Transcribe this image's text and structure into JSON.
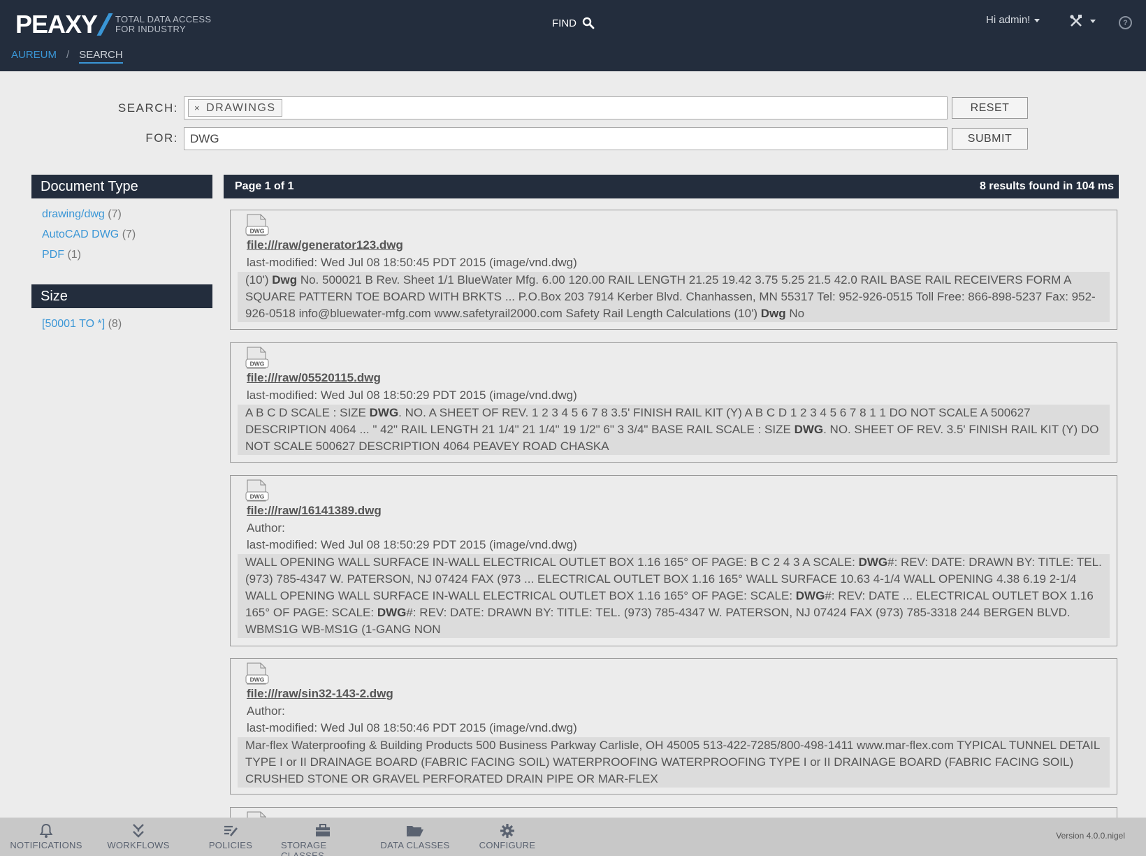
{
  "header": {
    "logo": "PEAXY",
    "tagline_line1": "TOTAL DATA ACCESS",
    "tagline_line2": "FOR INDUSTRY",
    "find_label": "FIND",
    "user_greeting": "Hi admin!",
    "help_label": "?",
    "breadcrumb": {
      "root": "AUREUM",
      "separator": "/",
      "current": "SEARCH"
    }
  },
  "search_form": {
    "search_label": "SEARCH:",
    "chip_remove": "×",
    "chip_label": "DRAWINGS",
    "for_label": "FOR:",
    "for_value": "DWG",
    "reset_label": "RESET",
    "submit_label": "SUBMIT"
  },
  "facets": {
    "doc_type_title": "Document Type",
    "doc_type_items": [
      {
        "label": "drawing/dwg",
        "count": "(7)"
      },
      {
        "label": "AutoCAD DWG",
        "count": "(7)"
      },
      {
        "label": "PDF",
        "count": "(1)"
      }
    ],
    "size_title": "Size",
    "size_items": [
      {
        "label": "[50001 TO *]",
        "count": "(8)"
      }
    ]
  },
  "results": {
    "page_label": "Page 1 of 1",
    "summary": "8 results found in 104 ms",
    "icon_label": "DWG",
    "items": [
      {
        "path": "file:///raw/generator123.dwg",
        "meta": "last-modified: Wed Jul 08 18:50:45 PDT 2015 (image/vnd.dwg)",
        "snippet_html": "(10') <b>Dwg</b> No. 500021 B Rev. Sheet 1/1 BlueWater Mfg. 6.00 120.00 RAIL LENGTH 21.25 19.42 3.75 5.25 21.5 42.0 RAIL BASE RAIL RECEIVERS FORM A SQUARE PATTERN TOE BOARD WITH BRKTS ... P.O.Box 203 7914 Kerber Blvd. Chanhassen, MN 55317 Tel: 952-926-0515 Toll Free: 866-898-5237 Fax: 952-926-0518 info@bluewater-mfg.com www.safetyrail2000.com Safety Rail Length Calculations (10') <b>Dwg</b> No"
      },
      {
        "path": "file:///raw/05520115.dwg",
        "meta": "last-modified: Wed Jul 08 18:50:29 PDT 2015 (image/vnd.dwg)",
        "snippet_html": "A B C D SCALE : SIZE <b>DWG</b>. NO. A SHEET OF REV. 1 2 3 4 5 6 7 8 3.5' FINISH RAIL KIT (Y) A B C D 1 2 3 4 5 6 7 8 1 1 DO NOT SCALE A 500627 DESCRIPTION 4064 ... \" 42\" RAIL LENGTH 21 1/4\" 21 1/4\" 19 1/2\" 6\" 3 3/4\" BASE RAIL SCALE : SIZE <b>DWG</b>. NO. SHEET OF REV. 3.5' FINISH RAIL KIT (Y) DO NOT SCALE 500627 DESCRIPTION 4064 PEAVEY ROAD CHASKA"
      },
      {
        "path": "file:///raw/16141389.dwg",
        "author": "Author:",
        "meta": "last-modified: Wed Jul 08 18:50:29 PDT 2015 (image/vnd.dwg)",
        "snippet_html": "WALL OPENING WALL SURFACE IN-WALL ELECTRICAL OUTLET BOX 1.16 165° OF PAGE: B C 2 4 3 A SCALE: <b>DWG</b>#: REV: DATE: DRAWN BY: TITLE: TEL. (973) 785-4347 W. PATERSON, NJ 07424 FAX (973 ... ELECTRICAL OUTLET BOX 1.16 165° WALL SURFACE 10.63 4-1/4 WALL OPENING 4.38 6.19 2-1/4 WALL OPENING WALL SURFACE IN-WALL ELECTRICAL OUTLET BOX 1.16 165° OF PAGE: SCALE: <b>DWG</b>#: REV: DATE ... ELECTRICAL OUTLET BOX 1.16 165° OF PAGE: SCALE: <b>DWG</b>#: REV: DATE: DRAWN BY: TITLE: TEL. (973) 785-4347 W. PATERSON, NJ 07424 FAX (973) 785-3318 244 BERGEN BLVD. WBMS1G WB-MS1G (1-GANG NON"
      },
      {
        "path": "file:///raw/sin32-143-2.dwg",
        "author": "Author:",
        "meta": "last-modified: Wed Jul 08 18:50:46 PDT 2015 (image/vnd.dwg)",
        "snippet_html": "Mar-flex Waterproofing &amp; Building Products 500 Business Parkway Carlisle, OH 45005 513-422-7285/800-498-1411 www.mar-flex.com TYPICAL TUNNEL DETAIL TYPE I or II DRAINAGE BOARD (FABRIC FACING SOIL) WATERPROOFING WATERPROOFING TYPE I or II DRAINAGE BOARD (FABRIC FACING SOIL) CRUSHED STONE OR GRAVEL PERFORATED DRAIN PIPE OR MAR-FLEX"
      }
    ]
  },
  "footer": {
    "nav": [
      {
        "label": "NOTIFICATIONS",
        "icon": "bell-icon"
      },
      {
        "label": "WORKFLOWS",
        "icon": "workflow-icon"
      },
      {
        "label": "POLICIES",
        "icon": "policy-icon"
      },
      {
        "label": "STORAGE CLASSES",
        "icon": "briefcase-icon"
      },
      {
        "label": "DATA CLASSES",
        "icon": "folder-icon"
      },
      {
        "label": "CONFIGURE",
        "icon": "gear-icon"
      }
    ],
    "version": "Version 4.0.0.nigel"
  },
  "colors": {
    "header_bg": "#232d3d",
    "accent": "#3a96d6",
    "page_bg": "#ececec",
    "footer_bg": "#c8c8c8"
  }
}
